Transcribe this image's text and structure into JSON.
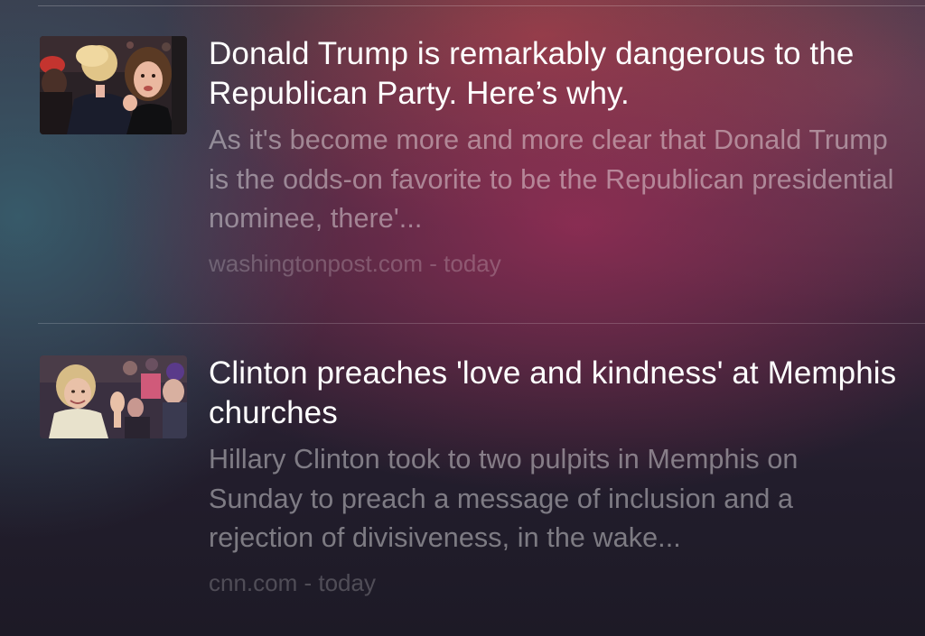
{
  "news": [
    {
      "headline": "Donald Trump is remarkably dangerous to the Republican Party. Here’s why.",
      "snippet": "As it's become more and more clear that Donald Trump is the odds-on favorite to be the Republican presidential nominee, there'...",
      "source": "washingtonpost.com",
      "separator": " - ",
      "time": "today"
    },
    {
      "headline": "Clinton preaches 'love and kindness' at Memphis churches",
      "snippet": "Hillary Clinton took to two pulpits in Memphis on Sunday to preach a message of inclusion and a rejection of divisiveness, in the wake...",
      "source": "cnn.com",
      "separator": " - ",
      "time": "today"
    }
  ]
}
